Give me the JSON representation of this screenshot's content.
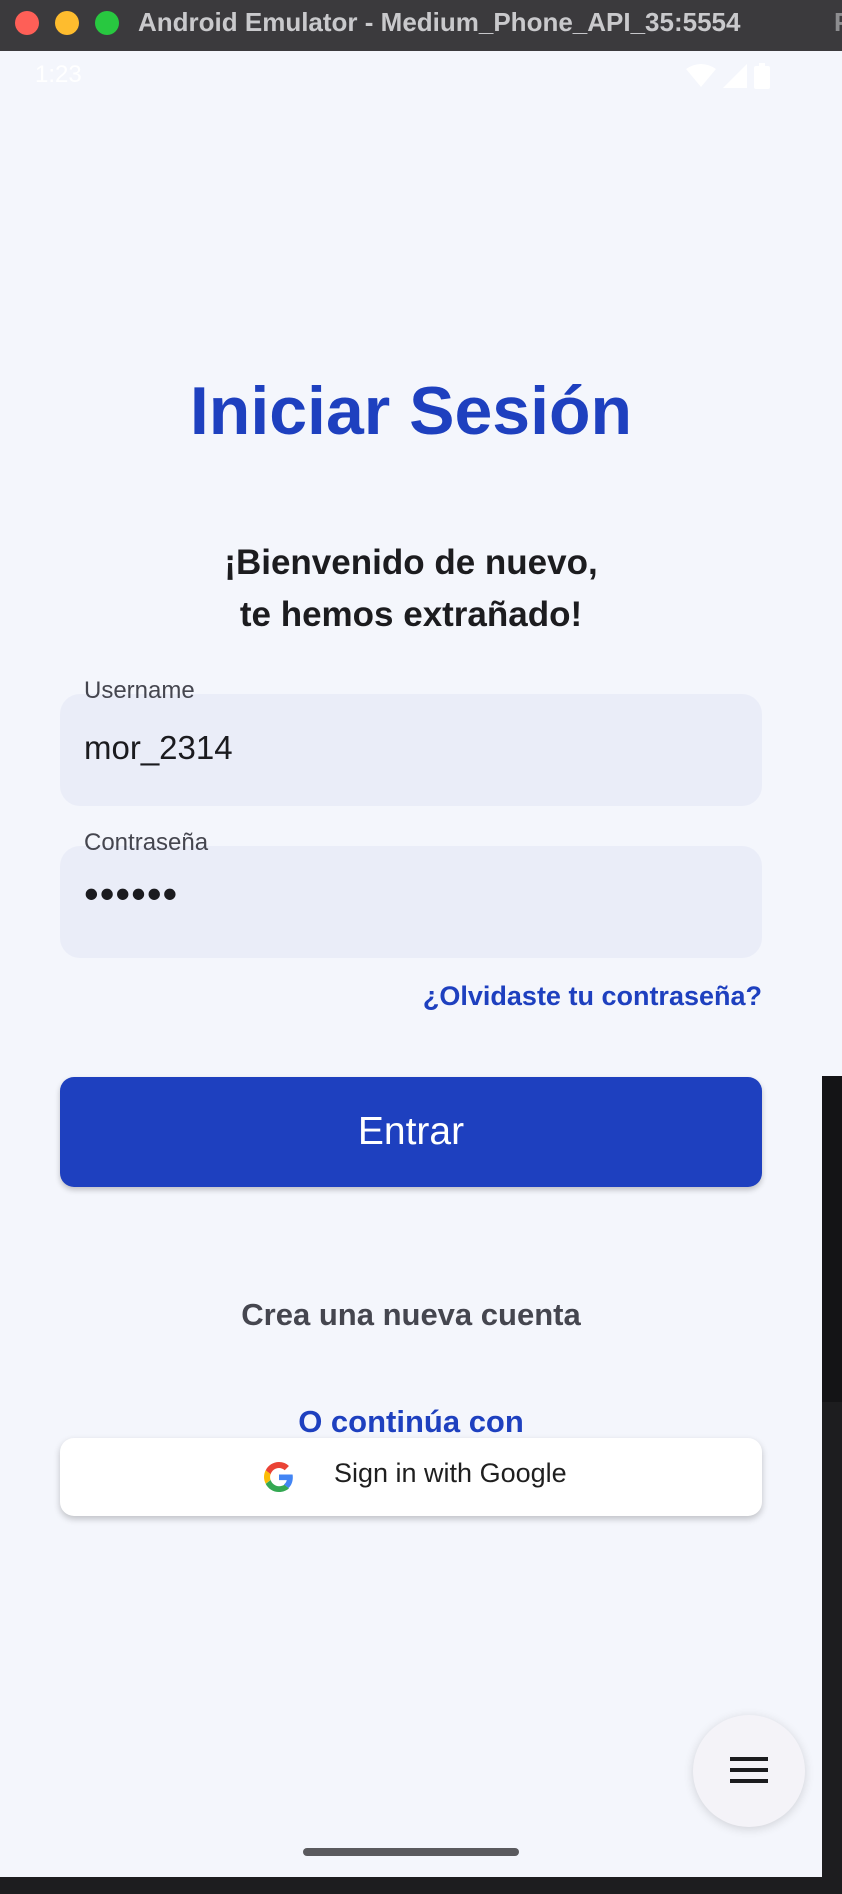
{
  "window": {
    "title": "Android Emulator - Medium_Phone_API_35:5554",
    "side_tab": "P"
  },
  "status_bar": {
    "time": "1:23"
  },
  "login": {
    "title": "Iniciar Sesión",
    "subtitle_line1": "¡Bienvenido de nuevo,",
    "subtitle_line2": "te hemos extrañado!",
    "username": {
      "label": "Username",
      "value": "mor_2314"
    },
    "password": {
      "label": "Contraseña",
      "value": "••••••"
    },
    "forgot_label": "¿Olvidaste tu contraseña?",
    "submit_label": "Entrar",
    "create_account_label": "Crea una nueva cuenta",
    "continue_with_label": "O continúa con",
    "google_label": "Sign in with Google"
  },
  "icons": {
    "fab": "menu-icon",
    "google": "google-logo-icon"
  },
  "colors": {
    "brand": "#1e40bf",
    "background": "#f4f6fc",
    "field": "#eaedf8"
  }
}
